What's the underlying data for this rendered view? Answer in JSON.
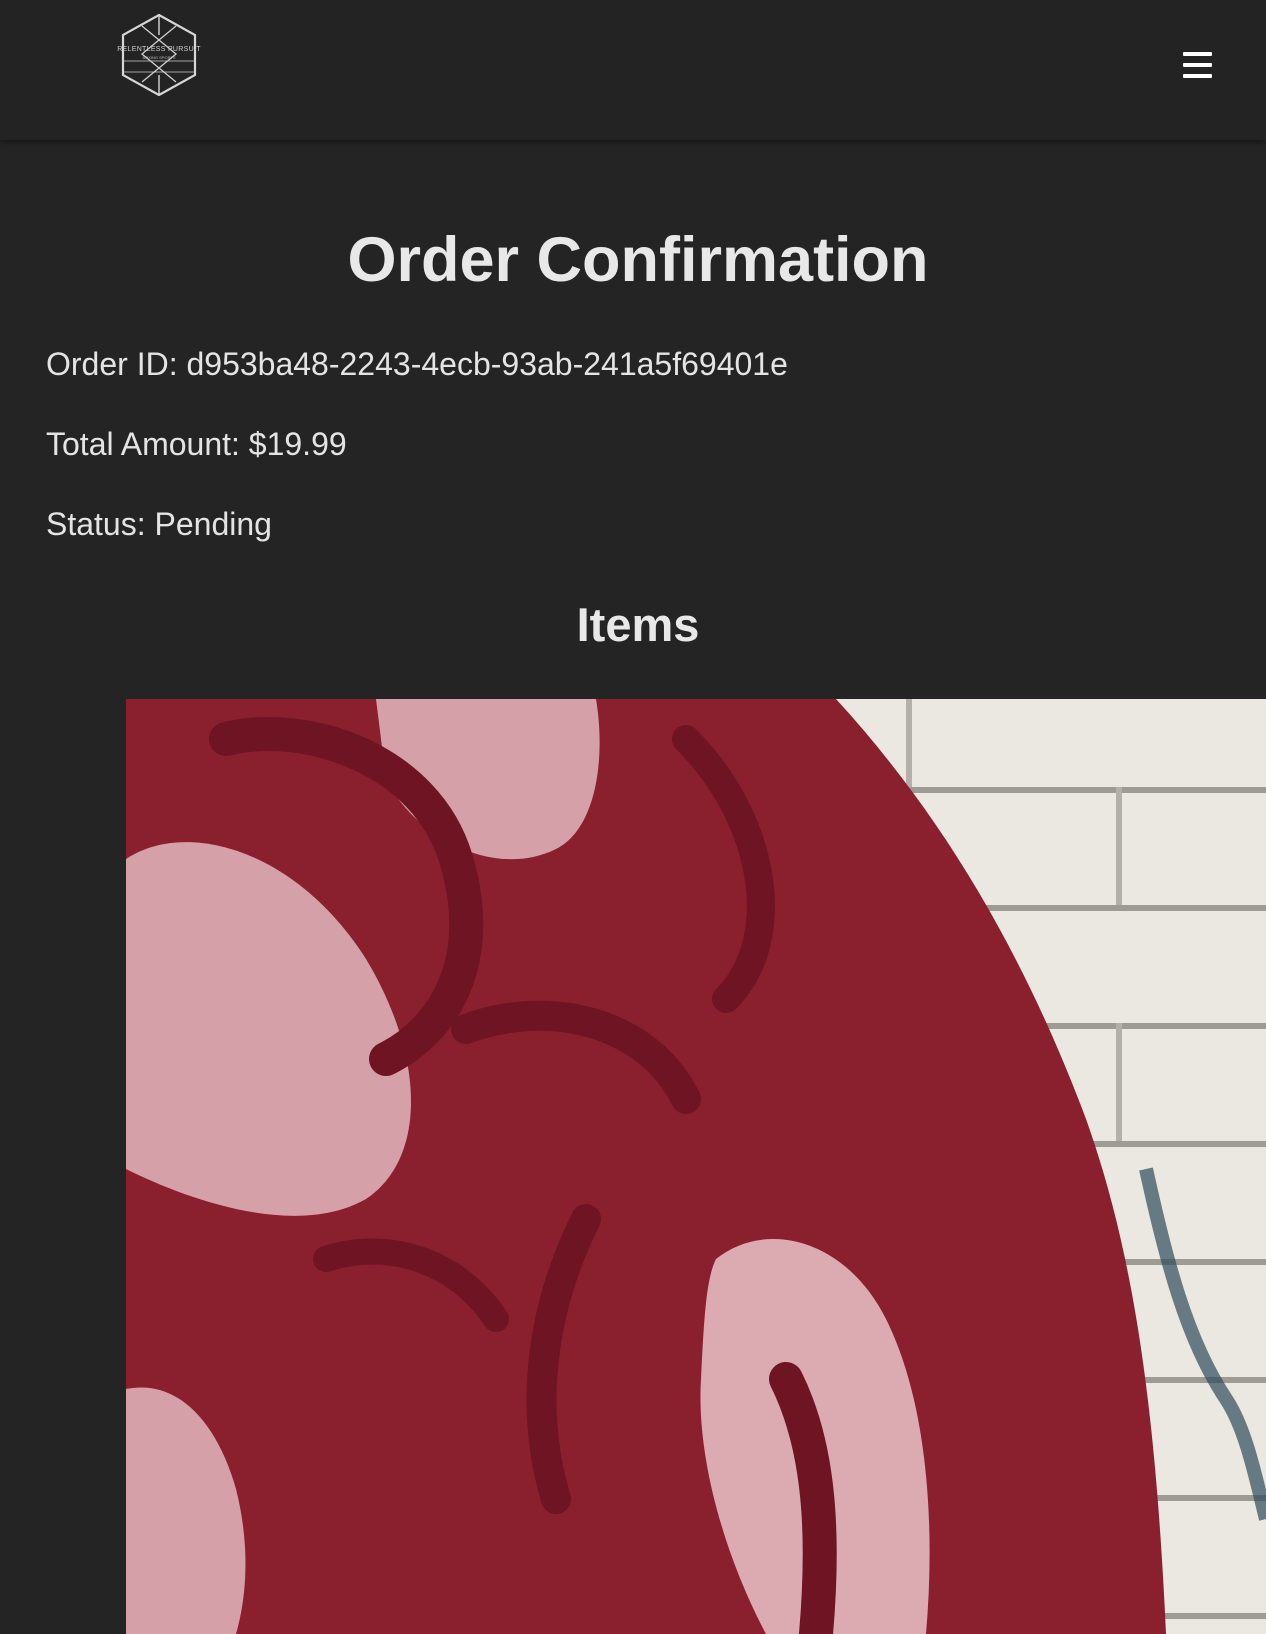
{
  "header": {
    "logo_text": "RELENTLESS PURSUIT",
    "logo_subtext": "BOXING SPORTS",
    "logo_icon": "hexagon-logo-icon",
    "menu_icon": "hamburger-menu-icon"
  },
  "page": {
    "title": "Order Confirmation",
    "order_id": "Order ID: d953ba48-2243-4ecb-93ab-241a5f69401e",
    "total_amount": "Total Amount: $19.99",
    "status": "Status: Pending",
    "items_heading": "Items"
  },
  "colors": {
    "background": "#242424",
    "header": "#232323",
    "text": "#e6e6e6",
    "graffiti_red": "#8a1f2e",
    "graffiti_pink": "#d9a3ad",
    "wall_white": "#e9e5df"
  }
}
